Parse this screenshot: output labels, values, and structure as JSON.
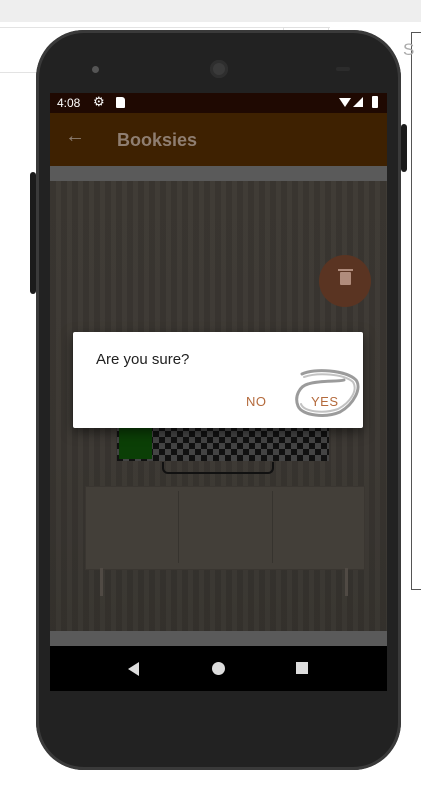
{
  "status_bar": {
    "time": "4:08"
  },
  "app_bar": {
    "title": "Booksies"
  },
  "dialog": {
    "message": "Are you sure?",
    "no_label": "NO",
    "yes_label": "YES"
  },
  "browser": {
    "side_letter": "S"
  },
  "colors": {
    "toolbar": "#3e2101",
    "status_bar": "#1f0902",
    "accent": "#b46a3c",
    "fab": "#5a3422"
  },
  "icons": [
    "back-arrow-icon",
    "gear-icon",
    "sd-card-icon",
    "wifi-icon",
    "signal-icon",
    "battery-icon",
    "trash-icon",
    "nav-back-icon",
    "nav-home-icon",
    "nav-recents-icon"
  ]
}
